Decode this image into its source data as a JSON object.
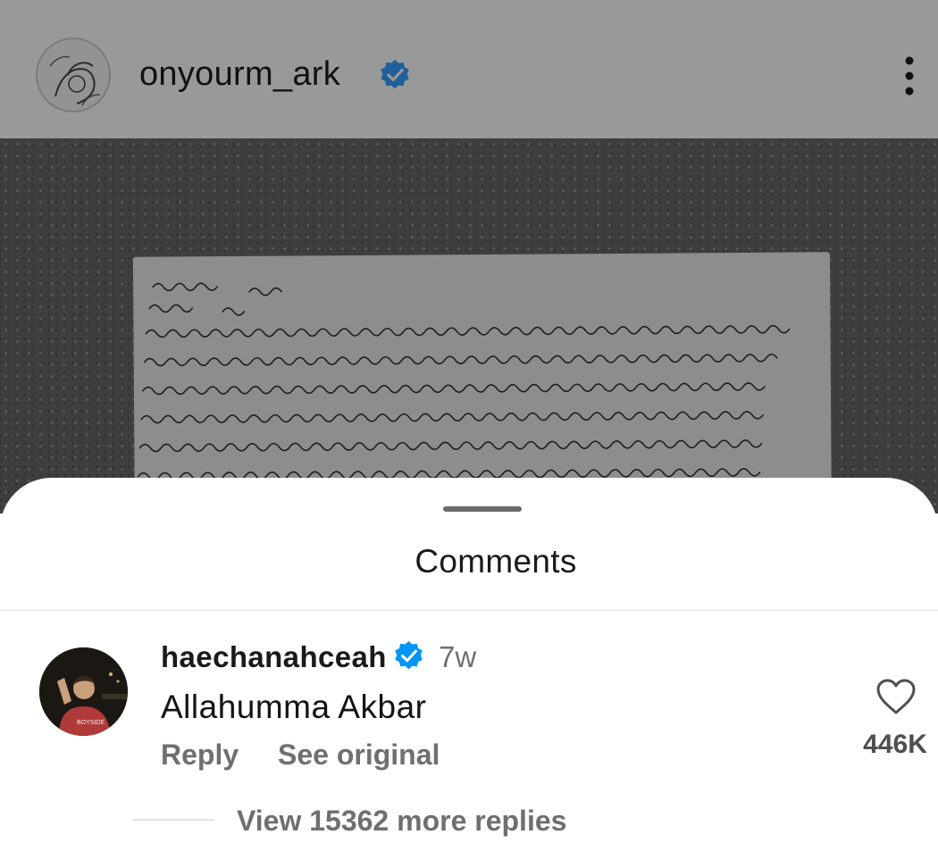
{
  "post": {
    "username": "onyourm_ark",
    "verified": true,
    "avatar_icon": "profile-sketch-avatar",
    "more_icon": "more-vertical-icon",
    "image_description_icon": "handwritten-letter-photo"
  },
  "comments_sheet": {
    "title": "Comments",
    "comment": {
      "username": "haechanahceah",
      "verified": true,
      "time": "7w",
      "text": "Allahumma Akbar",
      "reply_label": "Reply",
      "see_original_label": "See original",
      "like_count": "446K",
      "view_replies_label": "View 15362 more replies"
    }
  },
  "colors": {
    "verified_blue": "#0095f6",
    "overlay_grey": "#999999",
    "secondary_text": "#6f6f6f"
  }
}
